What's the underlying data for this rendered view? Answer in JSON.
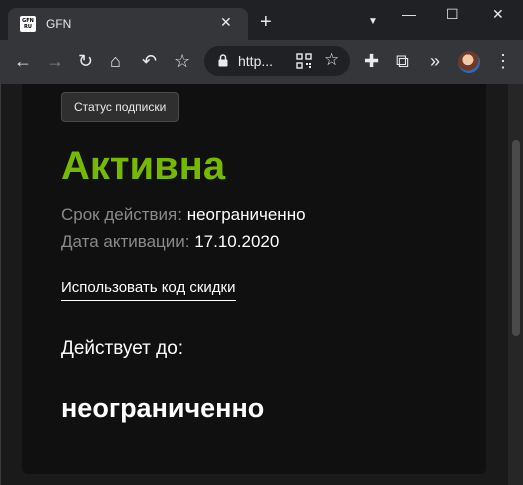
{
  "browser": {
    "tab": {
      "favicon_text": "GFN RU",
      "title": "GFN",
      "close": "✕"
    },
    "new_tab": "+",
    "tab_search": "▼",
    "window_controls": {
      "minimize": "—",
      "maximize": "☐",
      "close": "✕"
    },
    "toolbar": {
      "back": "←",
      "forward": "→",
      "reload": "↻",
      "home": "⌂",
      "undo": "↶",
      "bookmark": "☆",
      "url": "http...",
      "url_star": "☆",
      "extensions": "✚",
      "crop": "⧉",
      "more_extensions": "»",
      "menu": "⋮"
    }
  },
  "page": {
    "status_button": "Статус подписки",
    "status": "Активна",
    "validity_label": "Срок действия:",
    "validity_value": "неограниченно",
    "activation_label": "Дата активации:",
    "activation_value": "17.10.2020",
    "discount_link": "Использовать код скидки",
    "valid_until_label": "Действует до:",
    "valid_until_value": "неограниченно"
  },
  "colors": {
    "accent": "#76b900",
    "background": "#101010"
  }
}
